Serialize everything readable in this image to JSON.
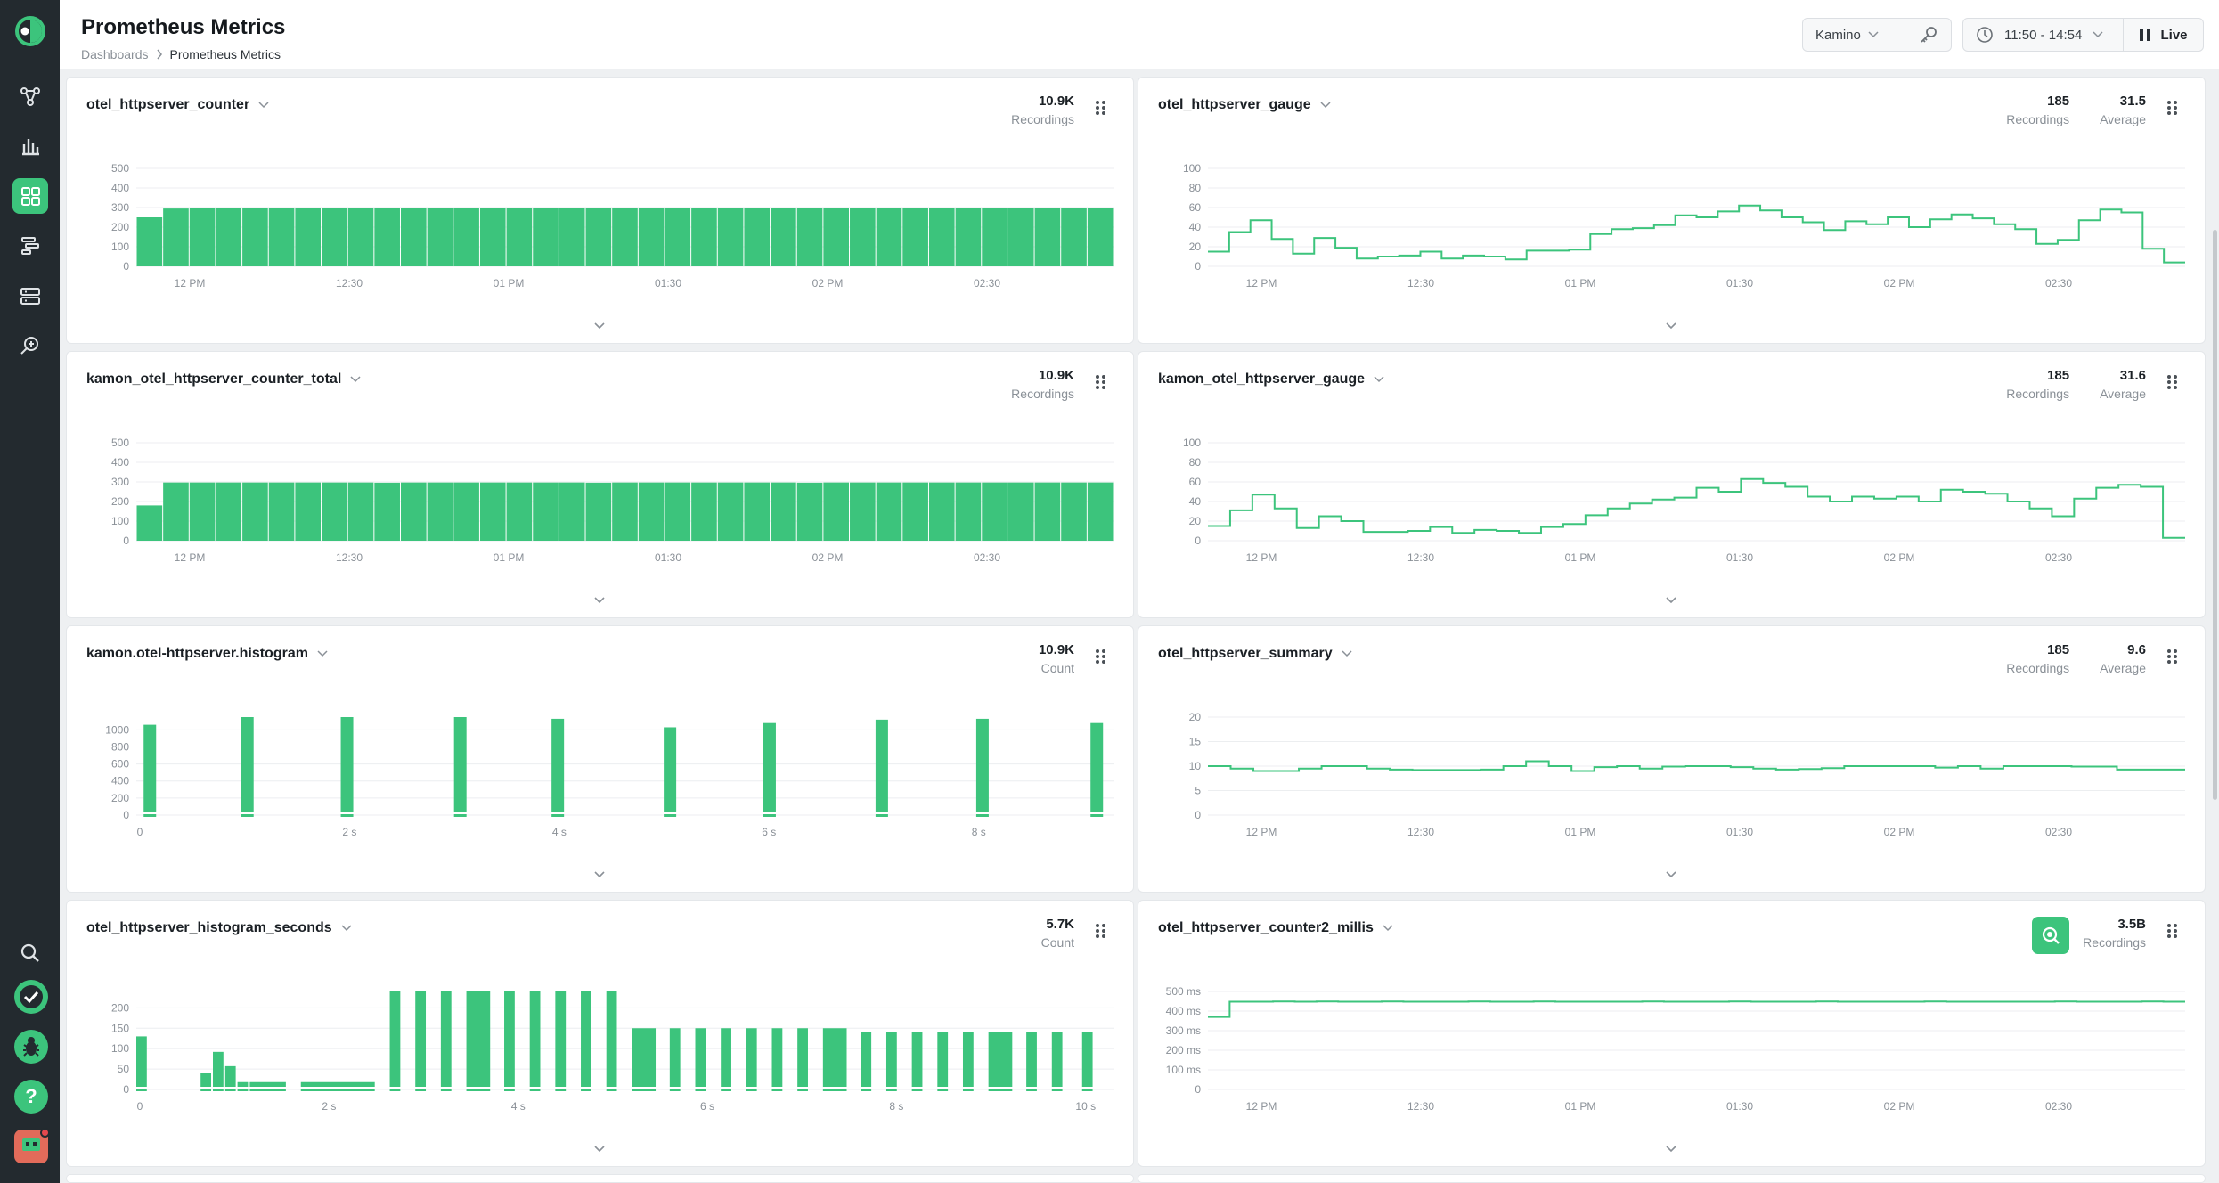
{
  "header": {
    "title": "Prometheus Metrics",
    "breadcrumb": [
      "Dashboards",
      "Prometheus Metrics"
    ],
    "environment": "Kamino",
    "time_range": "11:50 - 14:54",
    "live_label": "Live"
  },
  "sidebar": {
    "items": [
      "topology-icon",
      "bar-chart-icon",
      "dashboard-icon",
      "traces-icon",
      "server-icon",
      "search-analyze-icon"
    ],
    "bottom": [
      "search-icon",
      "check-icon",
      "bug-icon",
      "help-icon",
      "avatar"
    ],
    "help_glyph": "?"
  },
  "colors": {
    "accent": "#3cc47c",
    "sidebar": "#232a2f",
    "background": "#eef0f2"
  },
  "panels": [
    {
      "title": "otel_httpserver_counter",
      "stats": [
        {
          "value": "10.9K",
          "label": "Recordings"
        }
      ],
      "chart_data": {
        "type": "bar",
        "x_ticks": [
          "12 PM",
          "12:30",
          "01 PM",
          "01:30",
          "02 PM",
          "02:30"
        ],
        "y_ticks": [
          "500",
          "400",
          "300",
          "200",
          "100",
          "0"
        ],
        "ylim": [
          0,
          500
        ],
        "values": [
          250,
          295,
          297,
          297,
          297,
          297,
          297,
          297,
          297,
          297,
          297,
          296,
          297,
          297,
          297,
          297,
          296,
          297,
          297,
          297,
          297,
          297,
          296,
          297,
          297,
          297,
          297,
          297,
          296,
          297,
          297,
          297,
          297,
          297,
          297,
          297,
          297
        ]
      }
    },
    {
      "title": "otel_httpserver_gauge",
      "stats": [
        {
          "value": "185",
          "label": "Recordings"
        },
        {
          "value": "31.5",
          "label": "Average"
        }
      ],
      "chart_data": {
        "type": "line",
        "step": true,
        "x_ticks": [
          "12 PM",
          "12:30",
          "01 PM",
          "01:30",
          "02 PM",
          "02:30"
        ],
        "y_ticks": [
          "100",
          "80",
          "60",
          "40",
          "20",
          "0"
        ],
        "ylim": [
          0,
          100
        ],
        "values": [
          15,
          35,
          47,
          28,
          13,
          29,
          19,
          8,
          10,
          11,
          15,
          8,
          11,
          10,
          7,
          16,
          16,
          17,
          33,
          38,
          39,
          42,
          52,
          50,
          56,
          62,
          57,
          50,
          45,
          37,
          46,
          43,
          50,
          40,
          48,
          53,
          49,
          43,
          38,
          23,
          27,
          47,
          58,
          55,
          18,
          4
        ]
      }
    },
    {
      "title": "kamon_otel_httpserver_counter_total",
      "stats": [
        {
          "value": "10.9K",
          "label": "Recordings"
        }
      ],
      "chart_data": {
        "type": "bar",
        "x_ticks": [
          "12 PM",
          "12:30",
          "01 PM",
          "01:30",
          "02 PM",
          "02:30"
        ],
        "y_ticks": [
          "500",
          "400",
          "300",
          "200",
          "100",
          "0"
        ],
        "ylim": [
          0,
          500
        ],
        "values": [
          180,
          297,
          297,
          297,
          297,
          297,
          297,
          297,
          297,
          296,
          297,
          297,
          297,
          297,
          297,
          297,
          297,
          296,
          297,
          297,
          297,
          297,
          297,
          297,
          297,
          296,
          297,
          297,
          297,
          297,
          297,
          297,
          297,
          297,
          297,
          297,
          297
        ]
      }
    },
    {
      "title": "kamon_otel_httpserver_gauge",
      "stats": [
        {
          "value": "185",
          "label": "Recordings"
        },
        {
          "value": "31.6",
          "label": "Average"
        }
      ],
      "chart_data": {
        "type": "line",
        "step": true,
        "x_ticks": [
          "12 PM",
          "12:30",
          "01 PM",
          "01:30",
          "02 PM",
          "02:30"
        ],
        "y_ticks": [
          "100",
          "80",
          "60",
          "40",
          "20",
          "0"
        ],
        "ylim": [
          0,
          100
        ],
        "values": [
          15,
          31,
          47,
          33,
          13,
          25,
          20,
          9,
          9,
          10,
          14,
          8,
          11,
          10,
          8,
          14,
          17,
          26,
          33,
          38,
          42,
          44,
          54,
          50,
          63,
          59,
          55,
          45,
          40,
          45,
          43,
          45,
          40,
          52,
          50,
          48,
          40,
          33,
          25,
          43,
          54,
          57,
          55,
          3
        ]
      }
    },
    {
      "title": "kamon.otel-httpserver.histogram",
      "stats": [
        {
          "value": "10.9K",
          "label": "Count"
        }
      ],
      "chart_data": {
        "type": "bar",
        "x_ticks": [
          "0",
          "2 s",
          "4 s",
          "6 s",
          "8 s"
        ],
        "x_tick_values": [
          0,
          2,
          4,
          6,
          8
        ],
        "xlim": [
          0,
          9.2
        ],
        "y_ticks": [
          "1000",
          "800",
          "600",
          "400",
          "200",
          "0"
        ],
        "ylim": [
          0,
          1150
        ],
        "bars": [
          {
            "x": 0.07,
            "value": 1060
          },
          {
            "x": 1.0,
            "value": 1150
          },
          {
            "x": 1.95,
            "value": 1150
          },
          {
            "x": 3.03,
            "value": 1150
          },
          {
            "x": 3.96,
            "value": 1130
          },
          {
            "x": 5.03,
            "value": 1030
          },
          {
            "x": 5.98,
            "value": 1080
          },
          {
            "x": 7.05,
            "value": 1120
          },
          {
            "x": 8.01,
            "value": 1130
          },
          {
            "x": 9.1,
            "value": 1080
          }
        ]
      }
    },
    {
      "title": "otel_httpserver_summary",
      "stats": [
        {
          "value": "185",
          "label": "Recordings"
        },
        {
          "value": "9.6",
          "label": "Average"
        }
      ],
      "chart_data": {
        "type": "line",
        "step": true,
        "x_ticks": [
          "12 PM",
          "12:30",
          "01 PM",
          "01:30",
          "02 PM",
          "02:30"
        ],
        "y_ticks": [
          "20",
          "15",
          "10",
          "5",
          "0"
        ],
        "ylim": [
          0,
          20
        ],
        "values": [
          10,
          9.5,
          9,
          9,
          9.5,
          10,
          10,
          9.5,
          9.3,
          9.2,
          9.2,
          9.2,
          9.3,
          10,
          11,
          10,
          9,
          9.8,
          10,
          9.5,
          9.9,
          10,
          10,
          9.8,
          9.5,
          9.3,
          9.4,
          9.6,
          10,
          10,
          10,
          10,
          9.7,
          10,
          9.5,
          10,
          10,
          10,
          9.9,
          9.9,
          9.3,
          9.3,
          9.3
        ]
      }
    },
    {
      "title": "otel_httpserver_histogram_seconds",
      "stats": [
        {
          "value": "5.7K",
          "label": "Count"
        }
      ],
      "chart_data": {
        "type": "bar",
        "x_ticks": [
          "0",
          "2 s",
          "4 s",
          "6 s",
          "8 s",
          "10 s"
        ],
        "x_tick_values": [
          0,
          2,
          4,
          6,
          8,
          10
        ],
        "xlim": [
          0,
          10.2
        ],
        "y_ticks": [
          "200",
          "150",
          "100",
          "50",
          "0"
        ],
        "ylim": [
          0,
          240
        ],
        "bars": [
          {
            "x": 0.0,
            "w": 0.13,
            "value": 130
          },
          {
            "x": 0.68,
            "w": 0.13,
            "value": 40
          },
          {
            "x": 0.81,
            "w": 0.13,
            "value": 92
          },
          {
            "x": 0.94,
            "w": 0.13,
            "value": 57
          },
          {
            "x": 1.07,
            "w": 0.13,
            "value": 18
          },
          {
            "x": 1.2,
            "w": 0.4,
            "value": 18
          },
          {
            "x": 1.74,
            "w": 0.8,
            "value": 18
          },
          {
            "x": 2.68,
            "w": 0.13,
            "value": 240
          },
          {
            "x": 2.95,
            "w": 0.13,
            "value": 240
          },
          {
            "x": 3.22,
            "w": 0.13,
            "value": 240
          },
          {
            "x": 3.49,
            "w": 0.27,
            "value": 240
          },
          {
            "x": 3.89,
            "w": 0.13,
            "value": 240
          },
          {
            "x": 4.16,
            "w": 0.13,
            "value": 240
          },
          {
            "x": 4.43,
            "w": 0.13,
            "value": 240
          },
          {
            "x": 4.7,
            "w": 0.13,
            "value": 240
          },
          {
            "x": 4.97,
            "w": 0.13,
            "value": 240
          },
          {
            "x": 5.24,
            "w": 0.27,
            "value": 150
          },
          {
            "x": 5.64,
            "w": 0.13,
            "value": 150
          },
          {
            "x": 5.91,
            "w": 0.13,
            "value": 150
          },
          {
            "x": 6.18,
            "w": 0.13,
            "value": 150
          },
          {
            "x": 6.45,
            "w": 0.13,
            "value": 150
          },
          {
            "x": 6.72,
            "w": 0.13,
            "value": 150
          },
          {
            "x": 6.99,
            "w": 0.13,
            "value": 150
          },
          {
            "x": 7.26,
            "w": 0.27,
            "value": 150
          },
          {
            "x": 7.66,
            "w": 0.13,
            "value": 140
          },
          {
            "x": 7.93,
            "w": 0.13,
            "value": 140
          },
          {
            "x": 8.2,
            "w": 0.13,
            "value": 140
          },
          {
            "x": 8.47,
            "w": 0.13,
            "value": 140
          },
          {
            "x": 8.74,
            "w": 0.13,
            "value": 140
          },
          {
            "x": 9.01,
            "w": 0.27,
            "value": 140
          },
          {
            "x": 9.41,
            "w": 0.13,
            "value": 140
          },
          {
            "x": 9.68,
            "w": 0.13,
            "value": 140
          },
          {
            "x": 10.0,
            "w": 0.13,
            "value": 140
          }
        ]
      }
    },
    {
      "title": "otel_httpserver_counter2_millis",
      "search_badge": true,
      "stats": [
        {
          "value": "3.5B",
          "label": "Recordings"
        }
      ],
      "chart_data": {
        "type": "line",
        "step": true,
        "x_ticks": [
          "12 PM",
          "12:30",
          "01 PM",
          "01:30",
          "02 PM",
          "02:30"
        ],
        "y_ticks": [
          "500 ms",
          "400 ms",
          "300 ms",
          "200 ms",
          "100 ms",
          "0"
        ],
        "ylim": [
          0,
          500
        ],
        "values": [
          370,
          448,
          448,
          449,
          448,
          449,
          448,
          448,
          449,
          448,
          448,
          448,
          449,
          448,
          448,
          449,
          448,
          448,
          448,
          448,
          449,
          448,
          448,
          448,
          449,
          448,
          448,
          448,
          449,
          448,
          448,
          448,
          448,
          449,
          448,
          448,
          448,
          448,
          448,
          449,
          448,
          448,
          448,
          449,
          448
        ]
      }
    }
  ]
}
